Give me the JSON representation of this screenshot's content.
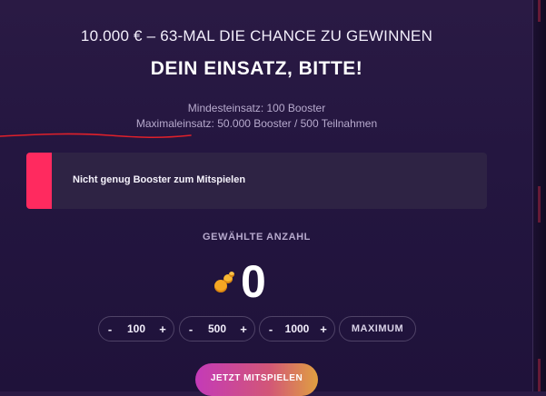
{
  "header": {
    "headline": "10.000 € – 63-MAL DIE CHANCE ZU GEWINNEN",
    "title": "DEIN EINSATZ, BITTE!"
  },
  "limits": {
    "min": "Mindesteinsatz: 100 Booster",
    "max": "Maximaleinsatz: 50.000 Booster / 500 Teilnahmen"
  },
  "alert": {
    "message": "Nicht genug Booster zum Mitspielen",
    "color": "#ff2a5f"
  },
  "selection": {
    "label": "GEWÄHLTE ANZAHL",
    "amount": "0",
    "icon": "coins-icon"
  },
  "steppers": [
    {
      "minus": "-",
      "value": "100",
      "plus": "+"
    },
    {
      "minus": "-",
      "value": "500",
      "plus": "+"
    },
    {
      "minus": "-",
      "value": "1000",
      "plus": "+"
    }
  ],
  "maximum_label": "MAXIMUM",
  "play_button": "JETZT MITSPIELEN",
  "colors": {
    "background": "#241640",
    "accent_pink": "#ff2a5f",
    "coin": "#f5a623",
    "scribble": "#e0202a"
  }
}
